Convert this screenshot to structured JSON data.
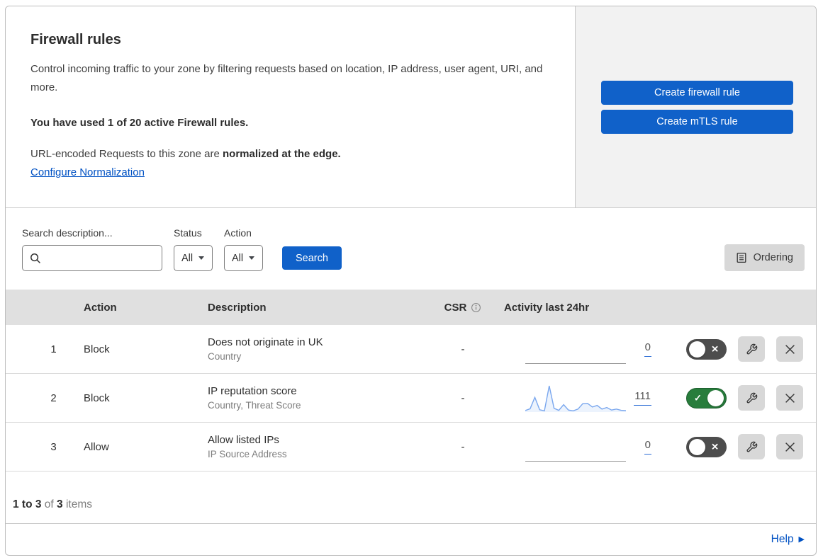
{
  "header": {
    "title": "Firewall rules",
    "description": "Control incoming traffic to your zone by filtering requests based on location, IP address, user agent, URI, and more.",
    "usage": "You have used 1 of 20 active Firewall rules.",
    "normalization_text": "URL-encoded Requests to this zone are ",
    "normalization_bold": "normalized at the edge.",
    "normalization_link": "Configure Normalization",
    "buttons": {
      "create_firewall_rule": "Create firewall rule",
      "create_mtls_rule": "Create mTLS rule"
    }
  },
  "filters": {
    "search_label": "Search description...",
    "search_value": "",
    "status_label": "Status",
    "status_value": "All",
    "action_label": "Action",
    "action_value": "All",
    "search_button": "Search",
    "ordering_button": "Ordering"
  },
  "table": {
    "columns": {
      "action": "Action",
      "description": "Description",
      "csr": "CSR",
      "activity": "Activity last 24hr"
    },
    "rows": [
      {
        "index": "1",
        "action": "Block",
        "description": "Does not originate in UK",
        "fields": "Country",
        "csr": "-",
        "activity_count": "0",
        "enabled": false
      },
      {
        "index": "2",
        "action": "Block",
        "description": "IP reputation score",
        "fields": "Country, Threat Score",
        "csr": "-",
        "activity_count": "111",
        "enabled": true,
        "sparkline": {
          "type": "line",
          "values": [
            3,
            10,
            55,
            6,
            2,
            100,
            12,
            4,
            26,
            5,
            2,
            9,
            30,
            31,
            17,
            23,
            9,
            15,
            5,
            9,
            4,
            3
          ],
          "color": "#7aa7ee",
          "fill": "rgba(122,167,238,0.14)"
        }
      },
      {
        "index": "3",
        "action": "Allow",
        "description": "Allow listed IPs",
        "fields": "IP Source Address",
        "csr": "-",
        "activity_count": "0",
        "enabled": false
      }
    ]
  },
  "footer": {
    "range": "1 to 3",
    "of": " of ",
    "total": "3",
    "items": " items",
    "help": "Help"
  },
  "icons": {
    "search": "magnifier",
    "dropdown": "caret-down",
    "ordering": "list-page",
    "csr_info": "info-circle",
    "toggle_off": "x-mark",
    "toggle_on": "check-mark",
    "configure": "wrench",
    "delete": "x",
    "help_arrow": "right-triangle"
  },
  "colors": {
    "primary_button": "#1061c9",
    "link": "#0051c3",
    "toggle_on": "#287d3c",
    "toggle_off": "#4d4d4d",
    "sparkline": "#7aa7ee",
    "table_header_bg": "#e0e0e0",
    "side_panel_bg": "#f2f2f2"
  }
}
